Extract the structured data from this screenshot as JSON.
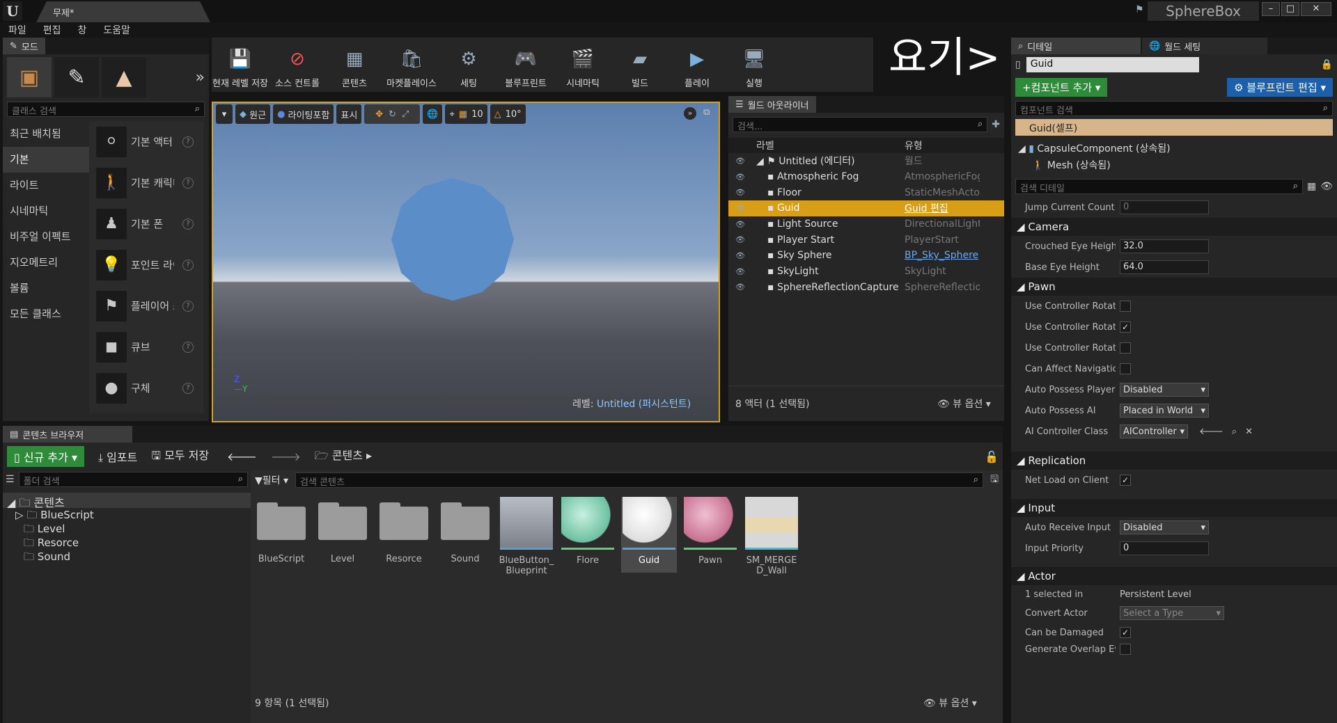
{
  "window": {
    "doc_tab": "무제*",
    "project": "SphereBox"
  },
  "menu": [
    "파일",
    "편집",
    "창",
    "도움말"
  ],
  "modes": {
    "tab": "모드",
    "search_placeholder": "클래스 검색",
    "categories": [
      "최근 배치됨",
      "기본",
      "라이트",
      "시네마틱",
      "비주얼 이펙트",
      "지오메트리",
      "볼륨",
      "모든 클래스"
    ],
    "active_category": 1,
    "items": [
      "기본 액터",
      "기본 캐릭터",
      "기본 폰",
      "포인트 라이트",
      "플레이어 스타트",
      "큐브",
      "구체"
    ]
  },
  "toolbar": {
    "buttons": [
      "현재 레벨 저장",
      "소스 컨트롤",
      "콘텐츠",
      "마켓플레이스",
      "세팅",
      "블루프린트",
      "시네마틱",
      "빌드",
      "플레이",
      "실행"
    ],
    "overlay_text": "요기>"
  },
  "viewport": {
    "perspective": "원근",
    "lit": "라이팅포함",
    "show": "표시",
    "grid_size": "10",
    "rot_snap": "10°",
    "level_label": "레벨:",
    "level_name": "Untitled (퍼시스턴트)"
  },
  "outliner": {
    "tab": "월드 아웃라이너",
    "search_placeholder": "검색...",
    "col_label": "라벨",
    "col_type": "유형",
    "rows": [
      {
        "name": "Untitled (에디터)",
        "type": "월드"
      },
      {
        "name": "Atmospheric Fog",
        "type": "AtmosphericFog"
      },
      {
        "name": "Floor",
        "type": "StaticMeshActor"
      },
      {
        "name": "Guid",
        "type": "Guid 편집"
      },
      {
        "name": "Light Source",
        "type": "DirectionalLight"
      },
      {
        "name": "Player Start",
        "type": "PlayerStart"
      },
      {
        "name": "Sky Sphere",
        "type": "BP_Sky_Sphere"
      },
      {
        "name": "SkyLight",
        "type": "SkyLight"
      },
      {
        "name": "SphereReflectionCapture",
        "type": "SphereReflectionCapture"
      }
    ],
    "selected_index": 3,
    "status": "8 액터 (1 선택됨)",
    "view_options": "뷰 옵션"
  },
  "details": {
    "tab_details": "디테일",
    "tab_world": "월드 세팅",
    "actor_name": "Guid",
    "add_component": "+컴포넌트 추가",
    "edit_blueprint": "블루프린트 편집",
    "comp_search": "컴포넌트 검색",
    "self": "Guid(셀프)",
    "components": [
      "CapsuleComponent (상속됨)",
      "Mesh (상속됨)"
    ],
    "detail_search": "검색 디테일",
    "jump_label": "Jump Current Count",
    "jump_value": "0",
    "camera": {
      "title": "Camera",
      "crouched_label": "Crouched Eye Height",
      "crouched": "32.0",
      "base_label": "Base Eye Height",
      "base": "64.0"
    },
    "pawn": {
      "title": "Pawn",
      "ctrl_rot": [
        "Use Controller Rotation Pitch",
        "Use Controller Rotation Yaw",
        "Use Controller Rotation Roll"
      ],
      "ctrl_checked": [
        false,
        true,
        false
      ],
      "affect_nav": "Can Affect Navigation",
      "auto_possess_player": "Auto Possess Player",
      "auto_possess_player_val": "Disabled",
      "auto_possess_ai": "Auto Possess AI",
      "auto_possess_ai_val": "Placed in World",
      "ai_class": "AI Controller Class",
      "ai_class_val": "AIController"
    },
    "replication": {
      "title": "Replication",
      "net_load": "Net Load on Client"
    },
    "input": {
      "title": "Input",
      "auto_receive": "Auto Receive Input",
      "auto_receive_val": "Disabled",
      "priority": "Input Priority",
      "priority_val": "0"
    },
    "actor": {
      "title": "Actor",
      "selected_in": "1 selected in",
      "persistent": "Persistent Level",
      "convert": "Convert Actor",
      "convert_val": "Select a Type",
      "damaged": "Can be Damaged",
      "overlap": "Generate Overlap Events"
    }
  },
  "content": {
    "tab": "콘텐츠 브라우저",
    "add_new": "신규 추가",
    "import": "임포트",
    "save_all": "모두 저장",
    "path": "콘텐츠",
    "folder_search": "폴더 검색",
    "filter": "필터",
    "content_search": "검색 콘텐츠",
    "tree_root": "콘텐츠",
    "tree": [
      "BlueScript",
      "Level",
      "Resorce",
      "Sound"
    ],
    "folders": [
      "BlueScript",
      "Level",
      "Resorce",
      "Sound"
    ],
    "assets": [
      "BlueButton_Blueprint",
      "Flore",
      "Guid",
      "Pawn",
      "SM_MERGED_Wall"
    ],
    "status": "9 항목 (1 선택됨)",
    "view_options": "뷰 옵션"
  },
  "colors": {
    "accent": "#d89e18",
    "green": "#2e8b3a",
    "blue": "#1d5fa8"
  }
}
